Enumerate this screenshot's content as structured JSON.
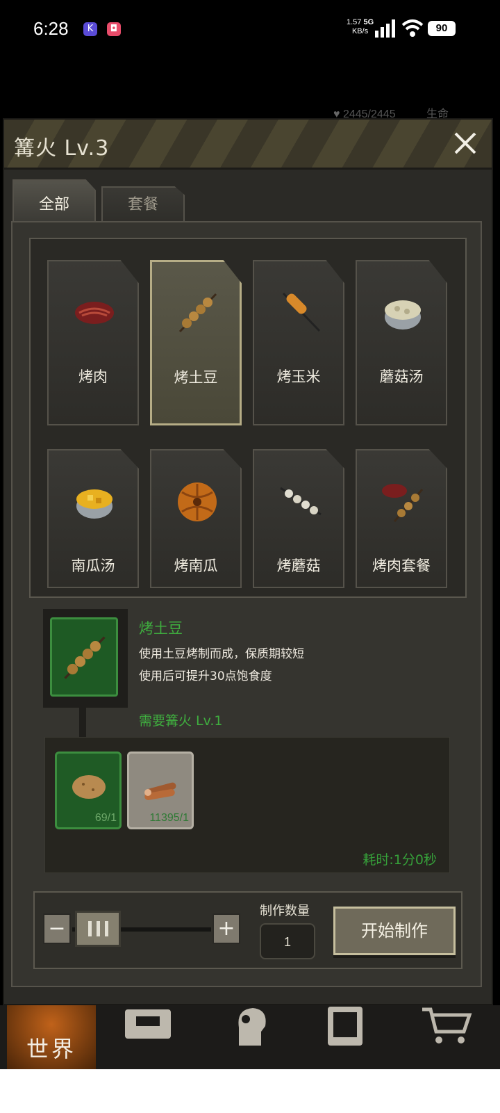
{
  "status_bar": {
    "time": "6:28",
    "app1": "K",
    "app2": "◘",
    "speed_value": "1.57",
    "speed_unit": "KB/s",
    "network": "5G",
    "battery": "90"
  },
  "background": {
    "hp": "2445/2445",
    "hp_label": "生命"
  },
  "dialog": {
    "title": "篝火 Lv.3",
    "tabs": [
      {
        "label": "全部"
      },
      {
        "label": "套餐"
      }
    ],
    "recipes": [
      {
        "label": "烤肉",
        "icon": "steak-icon"
      },
      {
        "label": "烤土豆",
        "icon": "potato-skewer-icon"
      },
      {
        "label": "烤玉米",
        "icon": "corn-skewer-icon"
      },
      {
        "label": "蘑菇汤",
        "icon": "mushroom-soup-icon"
      },
      {
        "label": "南瓜汤",
        "icon": "pumpkin-soup-icon"
      },
      {
        "label": "烤南瓜",
        "icon": "roast-pumpkin-icon"
      },
      {
        "label": "烤蘑菇",
        "icon": "mushroom-skewer-icon"
      },
      {
        "label": "烤肉套餐",
        "icon": "meat-combo-icon"
      }
    ],
    "detail": {
      "name": "烤土豆",
      "desc1": "使用土豆烤制而成，保质期较短",
      "desc2": "使用后可提升30点饱食度",
      "requirement": "需要篝火 Lv.1",
      "materials": [
        {
          "icon": "potato-icon",
          "count": "69/1"
        },
        {
          "icon": "firewood-icon",
          "count": "11395/1"
        }
      ],
      "time_cost": "耗时:1分0秒"
    },
    "control": {
      "minus": "−",
      "plus": "+",
      "qty_label": "制作数量",
      "qty_value": "1",
      "start_label": "开始制作"
    }
  },
  "bottom_nav": {
    "world_label": "世界"
  },
  "colors": {
    "accent_green": "#3fae3f",
    "selected_border": "#b6ad86"
  }
}
